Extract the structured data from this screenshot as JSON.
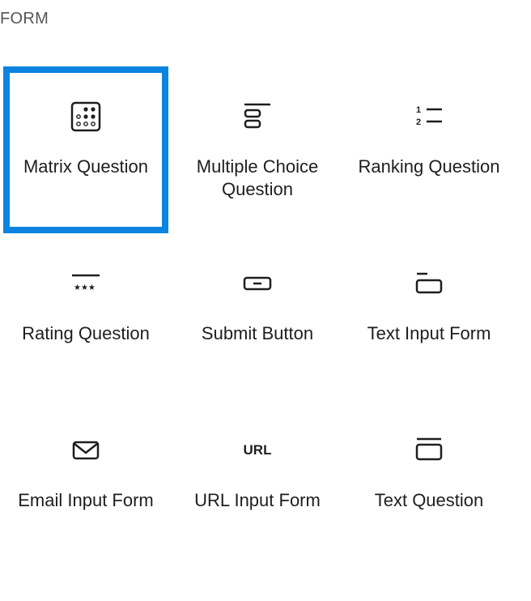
{
  "section": {
    "title": "FORM"
  },
  "blocks": [
    {
      "label": "Matrix Question",
      "icon": "matrix-grid-icon",
      "selected": true
    },
    {
      "label": "Multiple Choice Question",
      "icon": "multiple-choice-icon",
      "selected": false
    },
    {
      "label": "Ranking Question",
      "icon": "ranking-list-icon",
      "selected": false
    },
    {
      "label": "Rating Question",
      "icon": "rating-stars-icon",
      "selected": false
    },
    {
      "label": "Submit Button",
      "icon": "button-icon",
      "selected": false
    },
    {
      "label": "Text Input Form",
      "icon": "text-input-icon",
      "selected": false
    },
    {
      "label": "Email Input Form",
      "icon": "envelope-icon",
      "selected": false
    },
    {
      "label": "URL Input Form",
      "icon": "url-icon",
      "icon_text": "URL",
      "selected": false
    },
    {
      "label": "Text Question",
      "icon": "text-question-icon",
      "selected": false
    }
  ],
  "colors": {
    "selection_border": "#0a84e0",
    "text": "#1e1e1e",
    "header_text": "#555555"
  }
}
